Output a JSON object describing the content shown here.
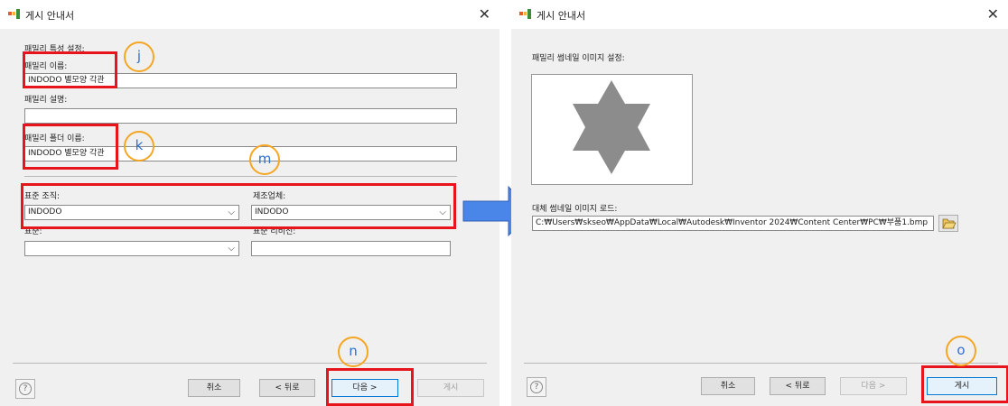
{
  "window1": {
    "title": "게시 안내서",
    "close": "✕",
    "section_label": "패밀리 특성 설정:",
    "family_name_label": "패밀리 이름:",
    "family_name_value": "INDODO 별모양 각관",
    "family_desc_label": "패밀리 설명:",
    "family_desc_value": "",
    "folder_name_label": "패밀리 폴더 이름:",
    "folder_name_value": "INDODO 별모양 각관",
    "std_org_label": "표준 조직:",
    "std_org_value": "INDODO",
    "manufacturer_label": "제조업체:",
    "manufacturer_value": "INDODO",
    "standard_label": "표준:",
    "standard_value": "",
    "std_revision_label": "표준 리비전:",
    "std_revision_value": "",
    "buttons": {
      "cancel": "취소",
      "back": "< 뒤로",
      "next": "다음 >",
      "publish": "게시"
    }
  },
  "window2": {
    "title": "게시 안내서",
    "close": "✕",
    "thumb_label": "패밀리 썸네일 이미지 설정:",
    "load_label": "대체 썸네일 이미지 로드:",
    "path_value": "C:₩Users₩skseo₩AppData₩Local₩Autodesk₩Inventor 2024₩Content Center₩PC₩부품1.bmp",
    "buttons": {
      "cancel": "취소",
      "back": "< 뒤로",
      "next": "다음 >",
      "publish": "게시"
    }
  },
  "annotations": {
    "j": "j",
    "k": "k",
    "m": "m",
    "n": "n",
    "o": "o"
  },
  "colors": {
    "highlight_red": "#e8141b",
    "circle_orange": "#f5a623",
    "arrow_blue": "#4a86e8",
    "letter_blue": "#2e6fd2"
  },
  "icons": {
    "help": "help-icon",
    "folder": "folder-open-icon",
    "arrow": "right-arrow-icon",
    "thumbnail": "star-icon"
  }
}
